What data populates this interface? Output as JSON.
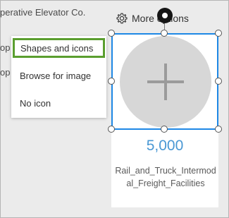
{
  "background": {
    "line1": "perative Elevator Co.",
    "line2": "op",
    "line3": "op"
  },
  "header": {
    "more_options_label": "More options"
  },
  "menu": {
    "items": [
      {
        "label": "Shapes and icons",
        "selected": true
      },
      {
        "label": "Browse for image",
        "selected": false
      },
      {
        "label": "No icon",
        "selected": false
      }
    ]
  },
  "card": {
    "value": "5,000",
    "caption": "Rail_and_Truck_Intermodal_Freight_Facilities",
    "placeholder_icon": "plus-icon"
  },
  "colors": {
    "accent_blue": "#1e88e5",
    "value_blue": "#4a98d4",
    "selected_green": "#5a9e2f",
    "circle_gray": "#d7d7d7"
  }
}
